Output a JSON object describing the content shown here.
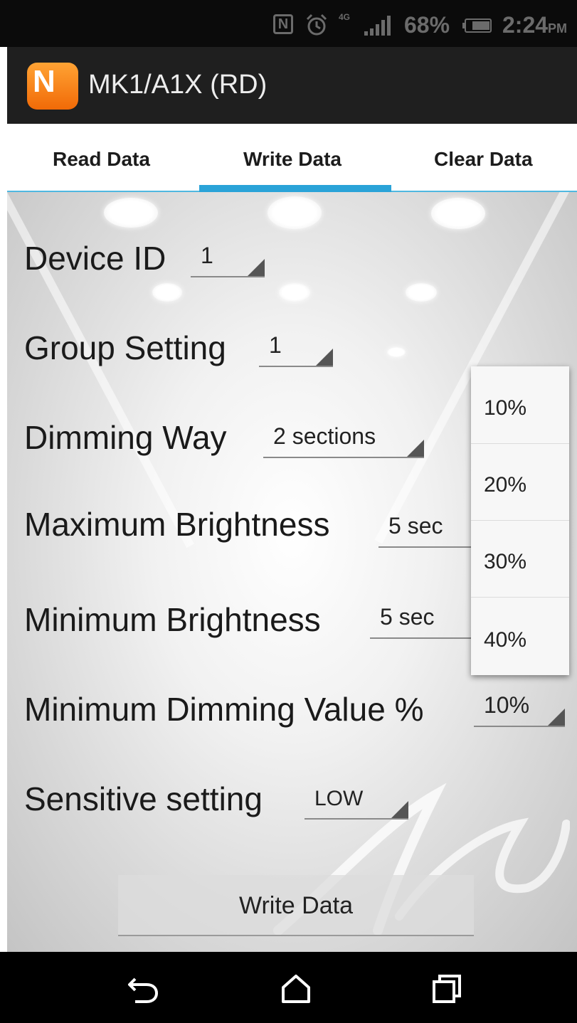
{
  "status_bar": {
    "nfc_icon": "nfc-icon",
    "alarm_icon": "alarm-icon",
    "network_type": "4G",
    "signal_icon": "signal-icon",
    "battery_percent": "68%",
    "battery_icon": "battery-icon",
    "time": "2:24",
    "ampm": "PM"
  },
  "app_bar": {
    "logo_letter": "N",
    "title": "MK1/A1X (RD)"
  },
  "tabs": [
    {
      "label": "Read Data",
      "selected": false
    },
    {
      "label": "Write Data",
      "selected": true
    },
    {
      "label": "Clear Data",
      "selected": false
    }
  ],
  "form": {
    "device_id": {
      "label": "Device ID",
      "value": "1"
    },
    "group_setting": {
      "label": "Group Setting",
      "value": "1"
    },
    "dimming_way": {
      "label": "Dimming Way",
      "value": "2 sections"
    },
    "maximum_brightness": {
      "label": "Maximum Brightness",
      "value": "5 sec"
    },
    "minimum_brightness": {
      "label": "Minimum Brightness",
      "value": "5 sec"
    },
    "minimum_dimming_value": {
      "label": "Minimum Dimming Value %",
      "value": "10%"
    },
    "sensitive_setting": {
      "label": "Sensitive setting",
      "value": "LOW"
    }
  },
  "dropdown_options": [
    "10%",
    "20%",
    "30%",
    "40%"
  ],
  "write_button": {
    "label": "Write Data"
  },
  "nav_bar": {
    "back_icon": "back-icon",
    "home_icon": "home-icon",
    "recent_icon": "recent-apps-icon"
  },
  "colors": {
    "tab_indicator": "#2aa3d8",
    "app_bar": "#1f1f1f",
    "logo_orange": "#f16a07"
  }
}
